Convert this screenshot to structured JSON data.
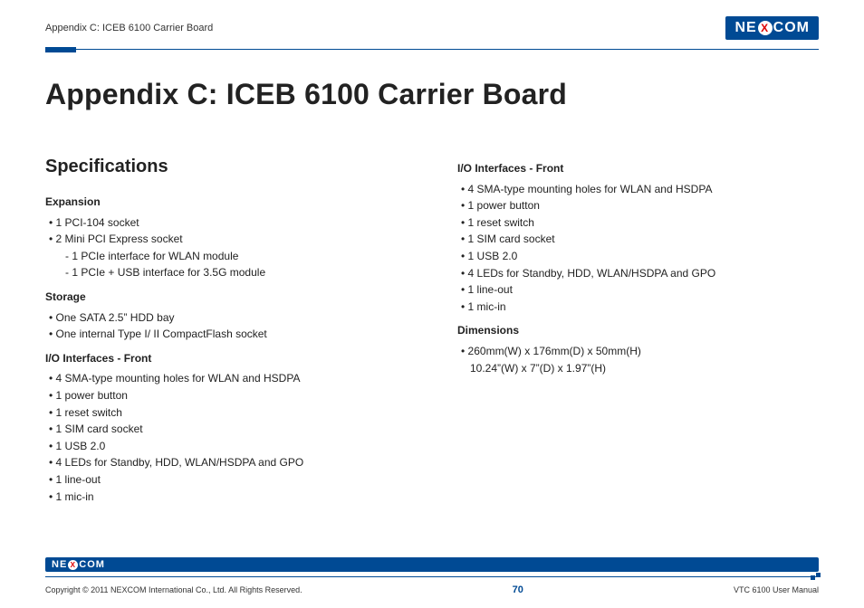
{
  "header": {
    "breadcrumb": "Appendix C: ICEB 6100 Carrier Board",
    "logo_text_left": "NE",
    "logo_text_x": "X",
    "logo_text_right": "COM"
  },
  "title": "Appendix C: ICEB 6100 Carrier Board",
  "left": {
    "section_heading": "Specifications",
    "groups": [
      {
        "head": "Expansion",
        "items": [
          {
            "text": "1 PCI-104 socket"
          },
          {
            "text": "2 Mini PCI Express socket",
            "sub": [
              "1 PCIe interface for WLAN module",
              "1 PCIe + USB interface for 3.5G module"
            ]
          }
        ]
      },
      {
        "head": "Storage",
        "items": [
          {
            "text": "One SATA 2.5” HDD bay"
          },
          {
            "text": "One internal Type I/ II CompactFlash socket"
          }
        ]
      },
      {
        "head": "I/O Interfaces - Front",
        "items": [
          {
            "text": "4 SMA-type mounting holes for WLAN and HSDPA"
          },
          {
            "text": "1 power button"
          },
          {
            "text": "1 reset switch"
          },
          {
            "text": "1 SIM card socket"
          },
          {
            "text": "1 USB 2.0"
          },
          {
            "text": "4 LEDs for Standby, HDD, WLAN/HSDPA and GPO"
          },
          {
            "text": "1 line-out"
          },
          {
            "text": "1 mic-in"
          }
        ]
      }
    ]
  },
  "right": {
    "groups": [
      {
        "head": "I/O Interfaces - Front",
        "items": [
          {
            "text": "4 SMA-type mounting holes for WLAN and HSDPA"
          },
          {
            "text": "1 power button"
          },
          {
            "text": "1 reset switch"
          },
          {
            "text": "1 SIM card socket"
          },
          {
            "text": "1 USB 2.0"
          },
          {
            "text": "4 LEDs for Standby, HDD, WLAN/HSDPA and GPO"
          },
          {
            "text": "1 line-out"
          },
          {
            "text": "1 mic-in"
          }
        ]
      },
      {
        "head": "Dimensions",
        "items": [
          {
            "text": "260mm(W) x 176mm(D) x 50mm(H)",
            "extra": "10.24”(W) x 7”(D) x 1.97”(H)"
          }
        ]
      }
    ]
  },
  "footer": {
    "copyright": "Copyright © 2011 NEXCOM International Co., Ltd. All Rights Reserved.",
    "page": "70",
    "doc": "VTC 6100 User Manual"
  }
}
